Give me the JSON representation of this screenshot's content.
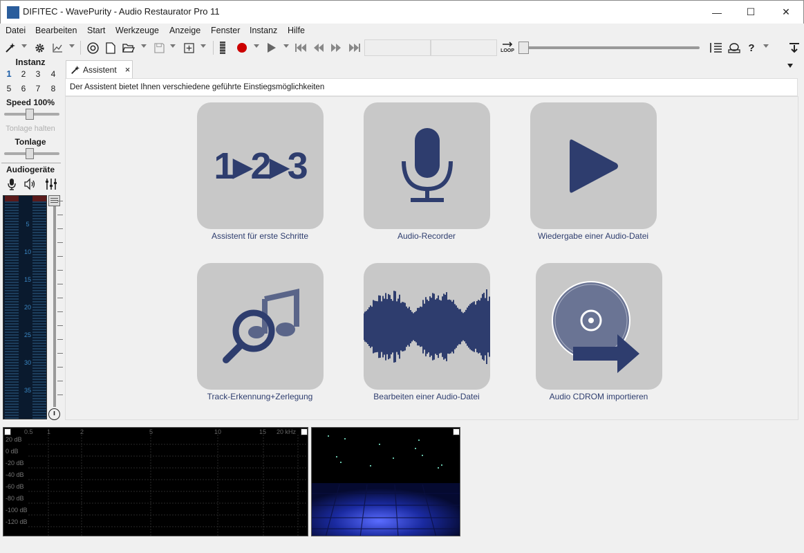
{
  "window": {
    "title": "DIFITEC - WavePurity - Audio Restaurator Pro 11",
    "minimize": "—",
    "maximize": "☐",
    "close": "✕"
  },
  "menu": [
    "Datei",
    "Bearbeiten",
    "Start",
    "Werkzeuge",
    "Anzeige",
    "Fenster",
    "Instanz",
    "Hilfe"
  ],
  "toolbar": {
    "loop_label": "LOOP",
    "help_label": "?"
  },
  "sidebar": {
    "instanz_title": "Instanz",
    "instances": [
      "1",
      "2",
      "3",
      "4",
      "5",
      "6",
      "7",
      "8"
    ],
    "active_instance": "1",
    "speed_label": "Speed 100%",
    "tonlage_halten": "Tonlage halten",
    "tonlage_label": "Tonlage",
    "audiogeraete_label": "Audiogeräte",
    "meter_labels": [
      "5",
      "10",
      "15",
      "20",
      "25",
      "30",
      "35"
    ]
  },
  "tabs": [
    {
      "label": "Assistent",
      "close": "×"
    }
  ],
  "assistant": {
    "header": "Der Assistent bietet Ihnen verschiedene geführte Einstiegsmöglichkeiten",
    "cards": [
      {
        "label": "Assistent für erste Schritte",
        "icon": "steps-123-icon"
      },
      {
        "label": "Audio-Recorder",
        "icon": "microphone-icon"
      },
      {
        "label": "Wiedergabe einer Audio-Datei",
        "icon": "play-icon"
      },
      {
        "label": "Track-Erkennung+Zerlegung",
        "icon": "music-search-icon"
      },
      {
        "label": "Bearbeiten einer Audio-Datei",
        "icon": "waveform-icon"
      },
      {
        "label": "Audio CDROM importieren",
        "icon": "cd-import-icon"
      }
    ],
    "steps_text": "1▸2▸3"
  },
  "spectrum": {
    "x_ticks": [
      "0.5",
      "1",
      "2",
      "5",
      "10",
      "15",
      "20 kHz"
    ],
    "y_ticks": [
      "20 dB",
      "0 dB",
      "-20 dB",
      "-40 dB",
      "-60 dB",
      "-80 dB",
      "-100 dB",
      "-120 dB"
    ]
  },
  "colors": {
    "accent": "#2e3d6e",
    "record": "#cc0000",
    "card_bg": "#c8c8c8"
  }
}
